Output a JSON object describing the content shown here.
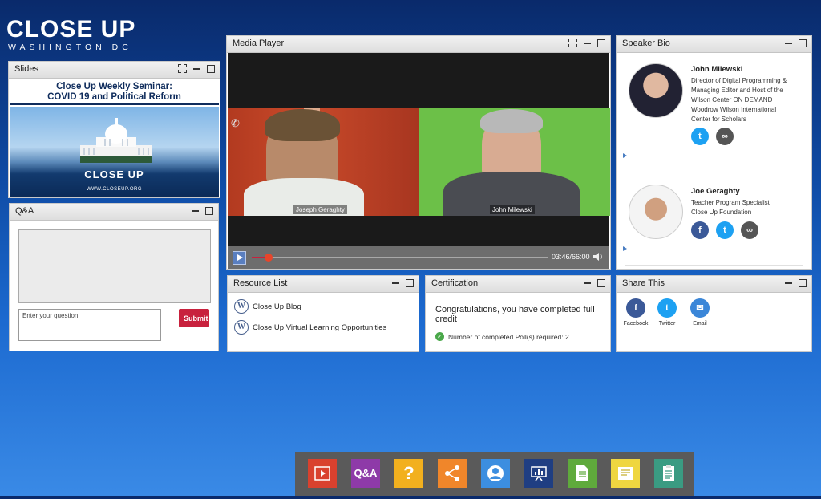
{
  "brand": {
    "name": "CLOSE UP",
    "subtitle": "WASHINGTON DC"
  },
  "slides": {
    "title": "Slides",
    "slide_title_line1": "Close Up Weekly Seminar:",
    "slide_title_line2": "COVID 19 and Political Reform",
    "slide_logo": "CLOSE UP",
    "slide_url": "WWW.CLOSEUP.ORG"
  },
  "qa": {
    "title": "Q&A",
    "input_placeholder": "Enter your question",
    "submit_label": "Submit"
  },
  "media_player": {
    "title": "Media Player",
    "speaker_left": "Joseph Geraghty",
    "speaker_right": "John Milewski",
    "time": "03:46/66:00",
    "progress": 0.057
  },
  "speaker_bio": {
    "title": "Speaker Bio",
    "speakers": [
      {
        "name": "John Milewski",
        "desc": [
          "Director of Digital Programming &",
          "Managing Editor and Host of the",
          "Wilson Center ON DEMAND",
          "Woodrow Wilson International",
          "Center for Scholars"
        ],
        "icons": [
          "twitter-icon",
          "link-icon"
        ]
      },
      {
        "name": "Joe Geraghty",
        "desc": [
          "Teacher Program Specialist",
          "Close Up Foundation"
        ],
        "icons": [
          "facebook-icon",
          "twitter-icon",
          "link-icon"
        ]
      }
    ]
  },
  "resource_list": {
    "title": "Resource List",
    "items": [
      "Close Up Blog",
      "Close Up Virtual Learning Opportunities"
    ]
  },
  "certification": {
    "title": "Certification",
    "message": "Congratulations, you have completed full credit",
    "status": "Number of completed Poll(s) required: 2"
  },
  "share": {
    "title": "Share This",
    "items": [
      "Facebook",
      "Twitter",
      "Email"
    ]
  },
  "dock": {
    "qa_label": "Q&A",
    "help_label": "?",
    "items": [
      {
        "name": "media-player",
        "color": "#d9412e"
      },
      {
        "name": "qa",
        "color": "#8e3aa8"
      },
      {
        "name": "help",
        "color": "#f2b01e"
      },
      {
        "name": "share",
        "color": "#f0862a"
      },
      {
        "name": "speaker-bio",
        "color": "#3c8ee0"
      },
      {
        "name": "slides",
        "color": "#1f3e82"
      },
      {
        "name": "resource-list",
        "color": "#5faa3c"
      },
      {
        "name": "certification",
        "color": "#efd640"
      },
      {
        "name": "survey",
        "color": "#3a9b82"
      }
    ]
  }
}
